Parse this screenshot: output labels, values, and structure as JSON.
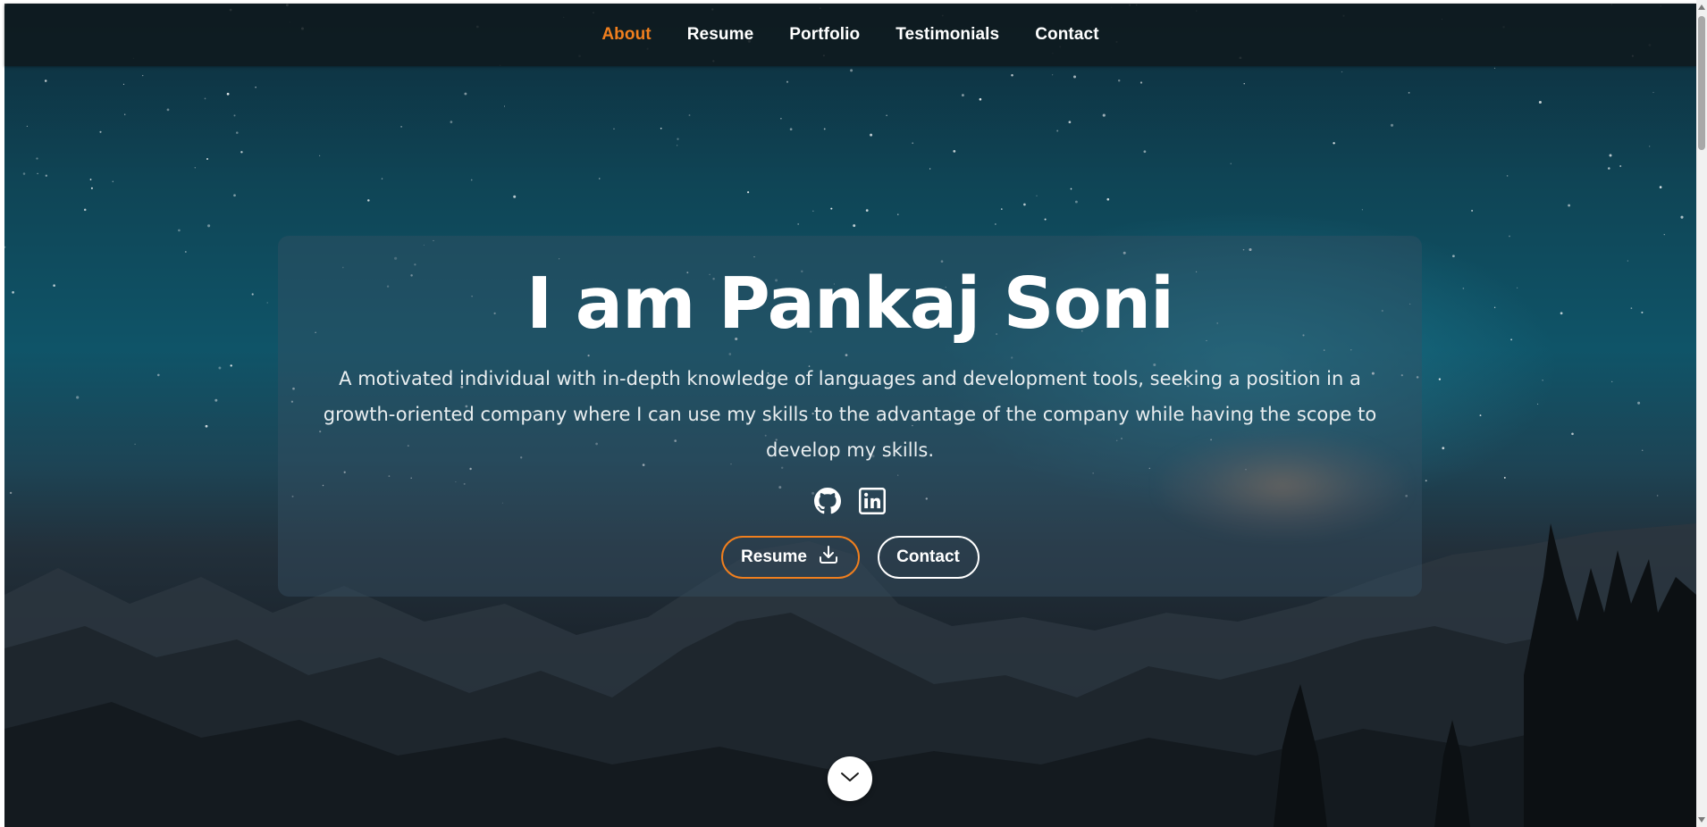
{
  "nav": {
    "items": [
      {
        "label": "About",
        "active": true
      },
      {
        "label": "Resume",
        "active": false
      },
      {
        "label": "Portfolio",
        "active": false
      },
      {
        "label": "Testimonials",
        "active": false
      },
      {
        "label": "Contact",
        "active": false
      }
    ]
  },
  "hero": {
    "title": "I am Pankaj Soni",
    "description": "A motivated individual with in-depth knowledge of languages and development tools, seeking a position in a growth-oriented company where I can use my skills to the advantage of the company while having the scope to develop my skills.",
    "social_icons": [
      "github-icon",
      "linkedin-icon"
    ],
    "buttons": {
      "resume_label": "Resume",
      "resume_icon": "download-icon",
      "contact_label": "Contact"
    }
  },
  "scroll_down_icon": "chevron-down-icon",
  "colors": {
    "accent": "#f07f1e",
    "nav_background": "#11191e",
    "text": "#ffffff"
  }
}
